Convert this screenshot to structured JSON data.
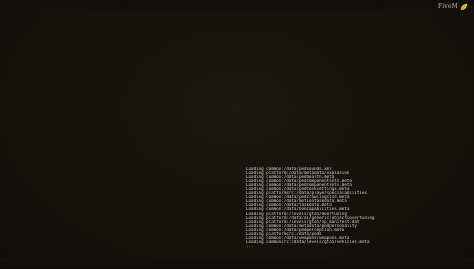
{
  "logo": {
    "text": "FiveM",
    "icon": "leaf-icon",
    "icon_color": "#e3c92a"
  },
  "colors": {
    "background": "#15120d",
    "log_text": "#d9d6cc"
  },
  "log_lines": [
    "Loading common:/data/pedsounds.xml",
    "Loading platform:/data/metadata/explosion",
    "Loading common:/data/pedhealth.meta",
    "Loading common:/data/pedcomponentsets.meta",
    "Loading common:/data/pedcomponentsets.meta",
    "Loading common:/data/pedtasksettings.meta",
    "Loading platformcrc:/data/playerspecialabilities",
    "Loading common:/data/pedcrawlingsize.meta",
    "Loading common:/data/motiontaskdata.meta",
    "Loading common:/data/taskdata.meta",
    "Loading common:/data/boncapabilities.meta",
    "Loading platform:/levels/gta5/doortuning",
    "Loading platform:/data/ai/generic/objectcovertuning",
    "Loading platform:/levels/gta5/vp_manifest.dat",
    "Loading common:/data/metadata/pedpersonality",
    "Loading common:/data/pedperception.meta",
    "Loading platformcrc:/data/peds",
    "Loading common:/data/weapons/weapons.meta",
    "Loading commoncrc:/data/levels/gta5/vehicles.meta",
    "..."
  ]
}
